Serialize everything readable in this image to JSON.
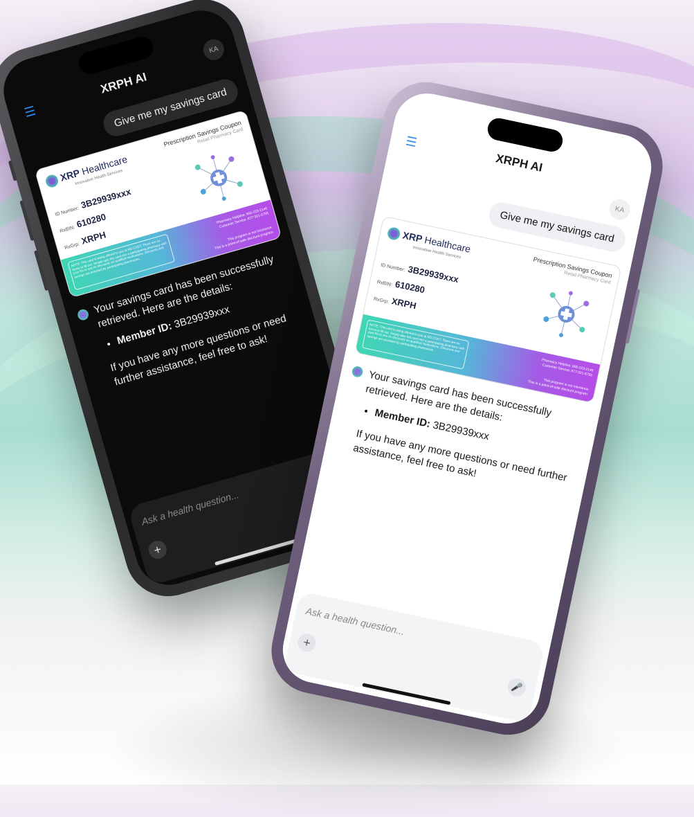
{
  "app": {
    "title": "XRPH AI",
    "avatar_initials": "KA"
  },
  "chat": {
    "user_message": "Give me my savings card",
    "reply_intro": "Your savings card has been successfully retrieved. Here are the details:",
    "member_label": "Member ID:",
    "member_value": "3B29939xxx",
    "reply_outro": "If you have any more questions or need further assistance, feel free to ask!"
  },
  "card": {
    "brand_bold": "XRP",
    "brand_rest": "Healthcare",
    "tagline": "Innovative Health Services",
    "title": "Prescription Savings Coupon",
    "subtitle": "Retail Pharmacy Card",
    "id_label": "ID Number:",
    "id_value": "3B29939xxx",
    "rxbin_label": "RxBIN:",
    "rxbin_value": "610280",
    "rxgrp_label": "RxGrp:",
    "rxgrp_value": "XRPH",
    "note": "NOTE: This card is being offered to you at NO COST. There are no forms to fill out. Simply take this card into a participating pharmacy with your Rx to see its discounts on qualified medications. Discounts and savings are provided by participating pharmacies.",
    "contact_pharmacy": "Pharmacy Helpline: 800-223-2146",
    "contact_customer": "Customer Service: 877-321-6755",
    "disclaimer_1": "This program is not insurance.",
    "disclaimer_2": "This is a point-of-sale discount program."
  },
  "composer": {
    "placeholder": "Ask a health question..."
  },
  "icons": {
    "menu": "menu-icon",
    "plus": "plus-icon",
    "mic": "microphone-icon",
    "bot": "assistant-icon"
  },
  "colors": {
    "accent": "#2d8cf0",
    "band_start": "#3fd6b4",
    "band_end": "#b54de8"
  }
}
